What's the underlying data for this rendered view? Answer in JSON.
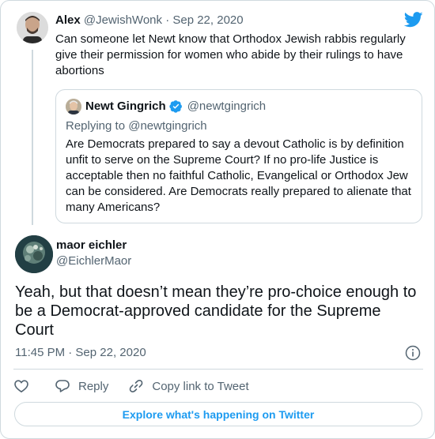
{
  "parent_tweet": {
    "name": "Alex",
    "handle": "@JewishWonk",
    "separator": "·",
    "date": "Sep 22, 2020",
    "text": "Can someone let Newt know that Orthodox Jewish rabbis regularly give their permission for women who abide by their rulings to have abortions"
  },
  "quoted_tweet": {
    "name": "Newt Gingrich",
    "handle": "@newtgingrich",
    "reply_context": "Replying to @newtgingrich",
    "text": "Are Democrats prepared to say a devout Catholic is by definition unfit to serve on the Supreme Court? If no pro-life Justice is acceptable then no faithful Catholic, Evangelical or Orthodox Jew can be considered. Are Democrats really prepared to alienate that many Americans?"
  },
  "main_tweet": {
    "name": "maor eichler",
    "handle": "@EichlerMaor",
    "text": "Yeah, but that doesn’t mean they’re pro-choice enough to be a Democrat-approved candidate for the Supreme Court",
    "timestamp": "11:45 PM · Sep 22, 2020"
  },
  "actions": {
    "reply_label": "Reply",
    "copy_link_label": "Copy link to Tweet"
  },
  "explore_label": "Explore what's happening on Twitter",
  "colors": {
    "twitter_blue": "#1d9bf0",
    "secondary_text": "#536471",
    "border": "#cfd9de"
  },
  "icons": [
    "twitter-bird-icon",
    "verified-badge-icon",
    "info-icon",
    "like-heart-icon",
    "reply-icon",
    "copy-link-icon"
  ]
}
